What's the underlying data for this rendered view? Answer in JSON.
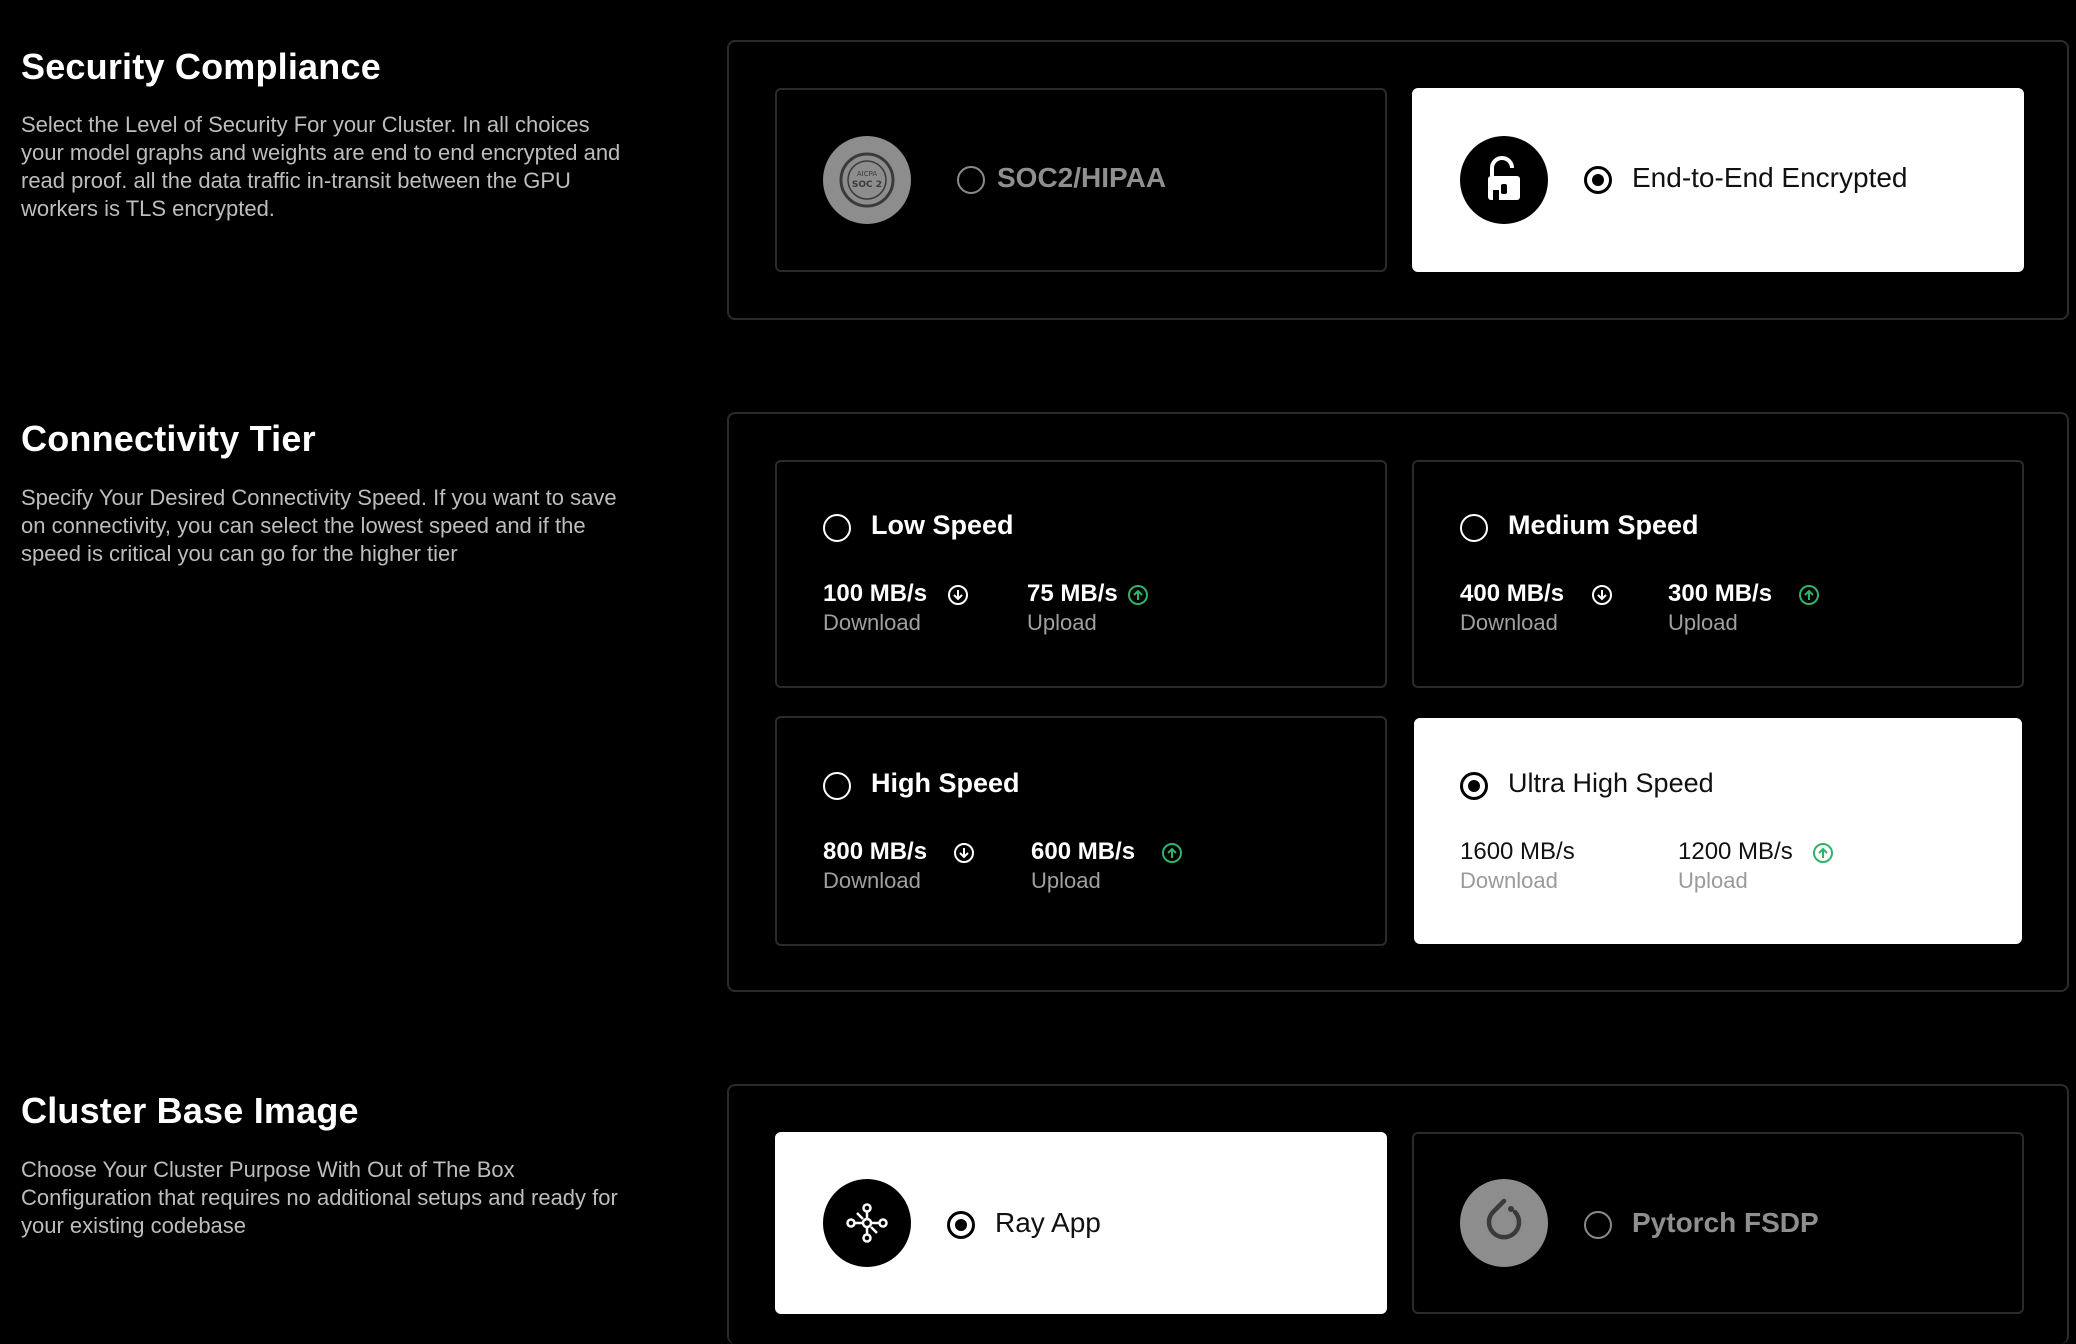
{
  "security": {
    "title": "Security Compliance",
    "description": "Select the Level of Security For your Cluster. In all choices your model graphs and weights are end to end encrypted and read proof. all the data traffic in-transit between the GPU workers is TLS encrypted.",
    "options": [
      {
        "label": "SOC2/HIPAA",
        "selected": false,
        "icon": "soc2-badge-icon"
      },
      {
        "label": "End-to-End Encrypted",
        "selected": true,
        "icon": "unlock-icon"
      }
    ]
  },
  "connectivity": {
    "title": "Connectivity Tier",
    "description": "Specify Your Desired Connectivity Speed. If you want to save on connectivity, you can select the lowest speed and if the speed is critical you can go for the higher tier",
    "download_label": "Download",
    "upload_label": "Upload",
    "tiers": [
      {
        "label": "Low Speed",
        "download": "100 MB/s",
        "upload": "75 MB/s",
        "selected": false
      },
      {
        "label": "Medium Speed",
        "download": "400 MB/s",
        "upload": "300 MB/s",
        "selected": false
      },
      {
        "label": "High Speed",
        "download": "800 MB/s",
        "upload": "600 MB/s",
        "selected": false
      },
      {
        "label": "Ultra High Speed",
        "download": "1600 MB/s",
        "upload": "1200 MB/s",
        "selected": true
      }
    ]
  },
  "base_image": {
    "title": "Cluster Base Image",
    "description": "Choose Your Cluster Purpose With Out of The Box Configuration that requires no additional setups and ready for your existing codebase",
    "options": [
      {
        "label": "Ray App",
        "selected": true,
        "icon": "ray-icon"
      },
      {
        "label": "Pytorch FSDP",
        "selected": false,
        "icon": "pytorch-icon"
      }
    ]
  },
  "colors": {
    "background": "#000000",
    "card_border": "#2b2b2b",
    "selected_card": "#ffffff",
    "upload_accent": "#2fb36a"
  }
}
